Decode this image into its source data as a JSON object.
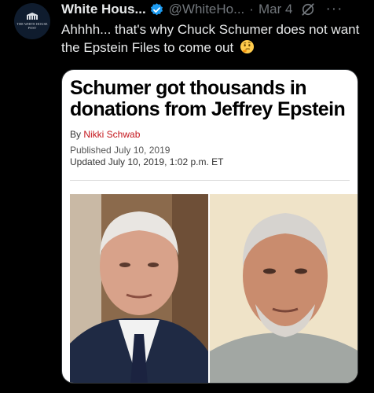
{
  "account": {
    "display_name": "White Hous...",
    "handle": "@WhiteHo...",
    "separator": "·",
    "date": "Mar 4",
    "avatar_text": "THE WHITE HOUSE POST"
  },
  "post": {
    "text": "Ahhhh... that's why Chuck Schumer does not want the Epstein Files to come out",
    "emoji_icon": "thinking-face-icon"
  },
  "more_label": "···",
  "article": {
    "headline": "Schumer got thousands in donations from Jeffrey Epstein",
    "byline_prefix": "By ",
    "author": "Nikki Schwab",
    "published": "Published July 10, 2019",
    "updated": "Updated July 10, 2019, 1:02 p.m. ET"
  },
  "colors": {
    "verified": "#1d9bf0",
    "author_link": "#c4161c",
    "muted": "#71767b"
  }
}
